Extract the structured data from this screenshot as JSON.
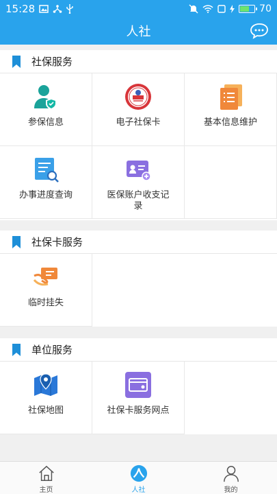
{
  "status": {
    "time": "15:28",
    "battery": "70",
    "battery_level": 0.7
  },
  "header": {
    "title": "人社"
  },
  "sections": [
    {
      "title": "社保服务",
      "items": [
        {
          "label": "参保信息",
          "icon": "person-shield-icon"
        },
        {
          "label": "电子社保卡",
          "icon": "social-security-seal-icon"
        },
        {
          "label": "基本信息维护",
          "icon": "document-list-icon"
        },
        {
          "label": "办事进度查询",
          "icon": "document-search-icon"
        },
        {
          "label": "医保账户收支记录",
          "icon": "medical-card-icon"
        }
      ]
    },
    {
      "title": "社保卡服务",
      "items": [
        {
          "label": "临时挂失",
          "icon": "hand-card-icon"
        }
      ]
    },
    {
      "title": "单位服务",
      "items": [
        {
          "label": "社保地图",
          "icon": "map-pin-icon"
        },
        {
          "label": "社保卡服务网点",
          "icon": "card-service-icon"
        }
      ]
    }
  ],
  "tabs": [
    {
      "label": "主页",
      "icon": "home-icon"
    },
    {
      "label": "人社",
      "icon": "hrss-logo-icon"
    },
    {
      "label": "我的",
      "icon": "user-icon"
    }
  ],
  "colors": {
    "primary": "#29a3ec",
    "accent_orange": "#f0883a",
    "accent_purple": "#8a6fe0",
    "accent_teal": "#1aa39a"
  }
}
